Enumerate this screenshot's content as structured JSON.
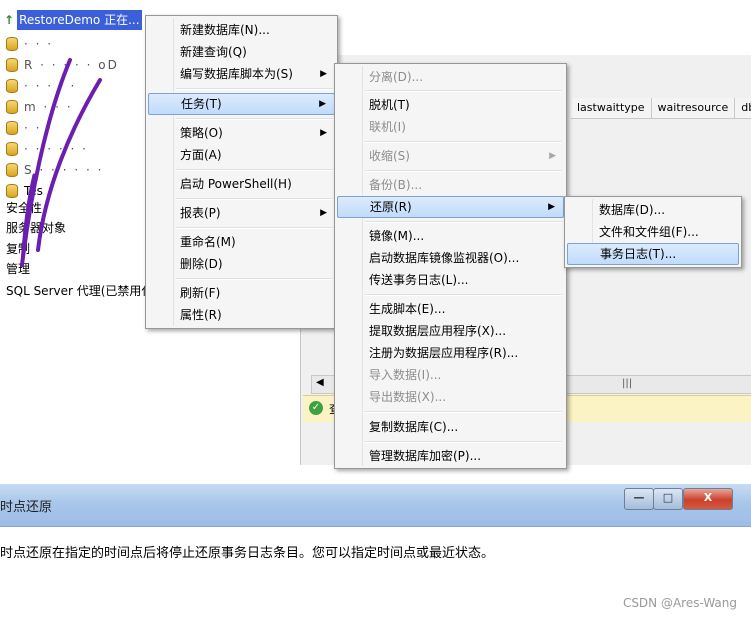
{
  "tree": {
    "root_label": "RestoreDemo",
    "root_status": "正在...",
    "items": [
      {
        "label": "· · ·",
        "obscured": true
      },
      {
        "label": "R · · · · · oD",
        "obscured": true
      },
      {
        "label": "· · · · ·",
        "obscured": true
      },
      {
        "label": "m · · ·",
        "obscured": true
      },
      {
        "label": "· · ·",
        "obscured": true
      },
      {
        "label": "· · · · · ·",
        "obscured": true
      },
      {
        "label": "S · · · · · ·",
        "obscured": true
      },
      {
        "label": "Tes",
        "obscured": false
      }
    ],
    "folders": [
      "安全性",
      "服务器对象",
      "复制",
      "管理"
    ],
    "agent_label": "SQL Server 代理(已禁用代"
  },
  "grid": {
    "columns": [
      "lastwaittype",
      "waitresource",
      "dbid"
    ],
    "status_text": "查"
  },
  "context_menu": {
    "items": [
      {
        "label": "新建数据库(N)...",
        "submenu": false
      },
      {
        "label": "新建查询(Q)",
        "submenu": false
      },
      {
        "label": "编写数据库脚本为(S)",
        "submenu": true
      },
      {
        "label": "任务(T)",
        "submenu": true,
        "highlighted": true
      },
      {
        "label": "策略(O)",
        "submenu": true
      },
      {
        "label": "方面(A)",
        "submenu": false
      },
      {
        "label": "启动 PowerShell(H)",
        "submenu": false
      },
      {
        "label": "报表(P)",
        "submenu": true
      },
      {
        "label": "重命名(M)",
        "submenu": false
      },
      {
        "label": "删除(D)",
        "submenu": false
      },
      {
        "label": "刷新(F)",
        "submenu": false
      },
      {
        "label": "属性(R)",
        "submenu": false
      }
    ]
  },
  "tasks_menu": {
    "items": [
      {
        "label": "分离(D)...",
        "disabled": true
      },
      {
        "label": "脱机(T)",
        "disabled": false
      },
      {
        "label": "联机(I)",
        "disabled": true
      },
      {
        "label": "收缩(S)",
        "disabled": true,
        "submenu": true
      },
      {
        "label": "备份(B)...",
        "disabled": true
      },
      {
        "label": "还原(R)",
        "disabled": false,
        "submenu": true,
        "highlighted": true
      },
      {
        "label": "镜像(M)...",
        "disabled": false
      },
      {
        "label": "启动数据库镜像监视器(O)...",
        "disabled": false
      },
      {
        "label": "传送事务日志(L)...",
        "disabled": false
      },
      {
        "label": "生成脚本(E)...",
        "disabled": false
      },
      {
        "label": "提取数据层应用程序(X)...",
        "disabled": false
      },
      {
        "label": "注册为数据层应用程序(R)...",
        "disabled": false
      },
      {
        "label": "导入数据(I)...",
        "disabled": true
      },
      {
        "label": "导出数据(X)...",
        "disabled": true
      },
      {
        "label": "复制数据库(C)...",
        "disabled": false
      },
      {
        "label": "管理数据库加密(P)...",
        "disabled": false
      }
    ]
  },
  "restore_menu": {
    "items": [
      {
        "label": "数据库(D)..."
      },
      {
        "label": "文件和文件组(F)..."
      },
      {
        "label": "事务日志(T)...",
        "highlighted": true
      }
    ]
  },
  "dialog": {
    "title": "时点还原",
    "description": "时点还原在指定的时间点后将停止还原事务日志条目。您可以指定时间点或最近状态。",
    "min_glyph": "—",
    "max_glyph": "□",
    "close_glyph": "X"
  },
  "watermark": "CSDN @Ares-Wang",
  "colors": {
    "selection": "#3b5fd8",
    "highlight": "#c1dbfc",
    "status_bar": "#fbf3c4",
    "scribble": "#6a1fb0"
  }
}
